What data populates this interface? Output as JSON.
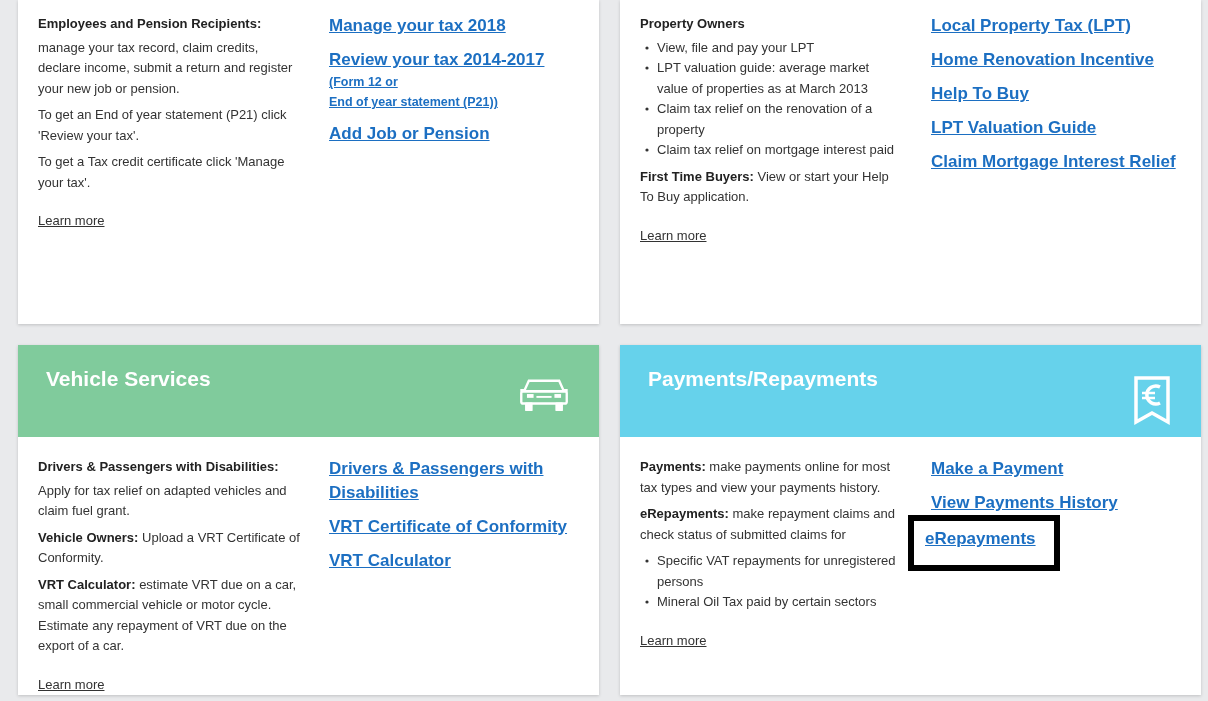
{
  "cards": [
    {
      "blocks": [
        {
          "kind": "heading",
          "text": "Employees and Pension Recipients:"
        },
        {
          "kind": "para",
          "text": "manage your tax record, claim credits, declare income, submit a return and register your new job or pension."
        },
        {
          "kind": "para",
          "text": "To get an End of year statement (P21) click 'Review your tax'."
        },
        {
          "kind": "para",
          "text": "To get a Tax credit certificate click 'Manage your tax'."
        }
      ],
      "links": [
        {
          "label": "Manage your tax 2018",
          "highlighted": false
        },
        {
          "label": "Review your tax 2014-2017",
          "notes": [
            "(Form 12 or",
            "End of year statement (P21))"
          ],
          "highlighted": false
        },
        {
          "label": "Add Job or Pension",
          "highlighted": false
        }
      ],
      "learn_more": "Learn more"
    },
    {
      "blocks": [
        {
          "kind": "heading",
          "text": "Property Owners"
        },
        {
          "kind": "bullets",
          "items": [
            "View, file and pay your LPT",
            "LPT valuation guide: average market value of properties as at March 2013",
            "Claim tax relief on the renovation of a property",
            "Claim tax relief on mortgage interest paid"
          ]
        },
        {
          "kind": "para",
          "text": "**First Time Buyers:** View or start your Help To Buy application."
        }
      ],
      "links": [
        {
          "label": "Local Property Tax (LPT)",
          "highlighted": false
        },
        {
          "label": "Home Renovation Incentive",
          "highlighted": false
        },
        {
          "label": "Help To Buy",
          "highlighted": false
        },
        {
          "label": "LPT Valuation Guide",
          "highlighted": false
        },
        {
          "label": "Claim Mortgage Interest Relief",
          "highlighted": false
        }
      ],
      "learn_more": "Learn more"
    },
    {
      "header": {
        "title": "Vehicle Services",
        "kind": "vehicle",
        "color": "#80cb9c"
      },
      "blocks": [
        {
          "kind": "heading",
          "text": "Drivers & Passengers with Disabilities:"
        },
        {
          "kind": "para",
          "text": "Apply for tax relief on adapted vehicles and claim fuel grant."
        },
        {
          "kind": "para",
          "text": "**Vehicle Owners:** Upload a VRT Certificate of Conformity."
        },
        {
          "kind": "para",
          "text": "**VRT Calculator:** estimate VRT due on a car, small commercial vehicle or motor cycle. Estimate any repayment of VRT due on the export of a car."
        }
      ],
      "links": [
        {
          "label": "Drivers & Passengers with Disabilities",
          "highlighted": false
        },
        {
          "label": "VRT Certificate of Conformity",
          "highlighted": false
        },
        {
          "label": "VRT Calculator",
          "highlighted": false
        }
      ],
      "learn_more": "Learn more"
    },
    {
      "header": {
        "title": "Payments/Repayments",
        "kind": "payments",
        "color": "#66d2eb"
      },
      "blocks": [
        {
          "kind": "para",
          "text": "**Payments:** make payments online for most tax types and view your payments history."
        },
        {
          "kind": "para",
          "text": "**eRepayments:** make repayment claims and check status of submitted claims for"
        },
        {
          "kind": "bullets",
          "items": [
            "Specific VAT repayments for unregistered persons",
            "Mineral Oil Tax paid by certain sectors"
          ]
        }
      ],
      "links": [
        {
          "label": "Make a Payment",
          "highlighted": false
        },
        {
          "label": "View Payments History",
          "highlighted": false
        },
        {
          "label": "eRepayments",
          "highlighted": true
        }
      ],
      "learn_more": "Learn more"
    }
  ]
}
